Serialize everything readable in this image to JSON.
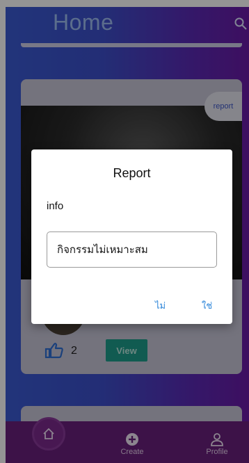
{
  "header": {
    "title": "Home"
  },
  "post": {
    "report_label": "report",
    "like_count": "2",
    "view_label": "View"
  },
  "dialog": {
    "title": "Report",
    "info_label": "info",
    "reason_value": "กิจกรรมไม่เหมาะสม",
    "no_label": "ไม่",
    "yes_label": "ใช่"
  },
  "nav": {
    "create_label": "Create",
    "profile_label": "Profile"
  },
  "colors": {
    "accent": "#2e86d9",
    "view_button": "#1e9d8c",
    "nav_background": "#6a1f7c"
  }
}
